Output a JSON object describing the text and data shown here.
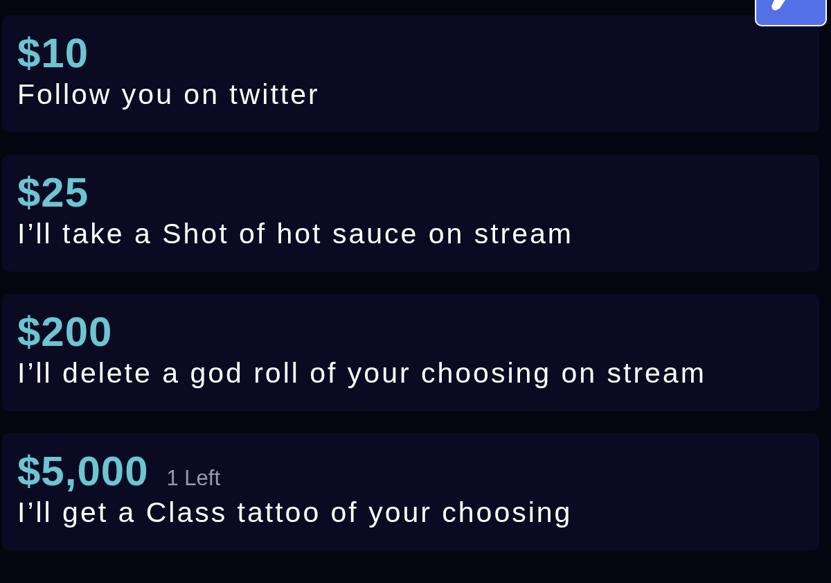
{
  "tiers": [
    {
      "price": "$10",
      "description": "Follow you on twitter"
    },
    {
      "price": "$25",
      "description": "I’ll take a Shot of hot sauce on stream"
    },
    {
      "price": "$200",
      "description": "I’ll delete a god roll of your choosing on stream"
    },
    {
      "price": "$5,000",
      "remaining": "1 Left",
      "description": "I’ll get a Class tattoo of your choosing"
    }
  ]
}
